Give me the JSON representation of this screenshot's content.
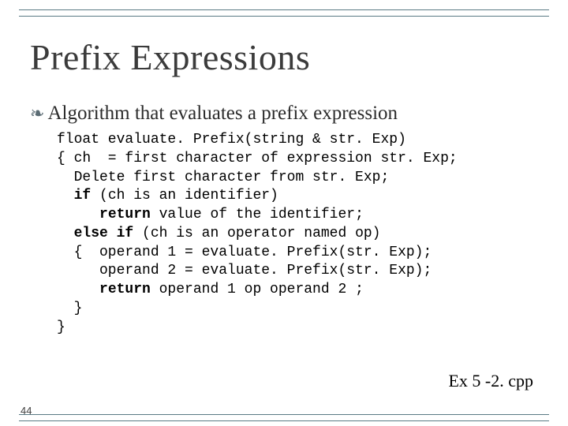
{
  "slide": {
    "title": "Prefix Expressions",
    "bullet_glyph": "❧",
    "subtitle": "Algorithm that evaluates a prefix expression",
    "code": {
      "l1": "float evaluate. Prefix(string & str. Exp)",
      "l2": "{ ch  = first character of expression str. Exp;",
      "l3": "  Delete first character from str. Exp;",
      "l4a": "  ",
      "l4b": "if",
      "l4c": " (ch is an identifier)",
      "l5a": "     ",
      "l5b": "return",
      "l5c": " value of the identifier;",
      "l6a": "  ",
      "l6b": "else if",
      "l6c": " (ch is an operator named op)",
      "l7": "  {  operand 1 = evaluate. Prefix(str. Exp);",
      "l8": "     operand 2 = evaluate. Prefix(str. Exp);",
      "l9a": "     ",
      "l9b": "return",
      "l9c": " operand 1 op operand 2 ;",
      "l10": "  }",
      "l11": "}"
    },
    "footer_ref": "Ex 5 -2. cpp",
    "page_number": "44"
  }
}
